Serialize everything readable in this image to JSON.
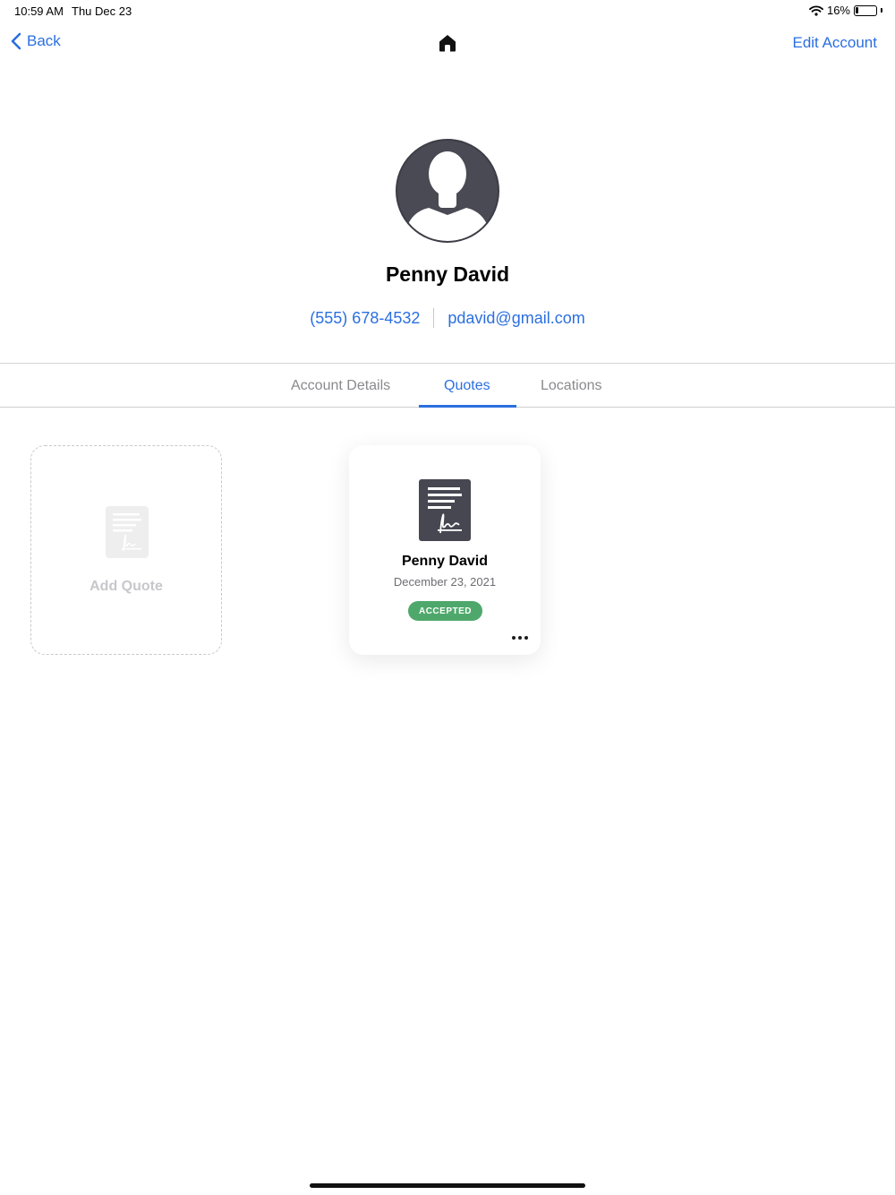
{
  "status_bar": {
    "time": "10:59 AM",
    "date": "Thu Dec 23",
    "battery": "16%",
    "battery_level": 0.16,
    "icons": [
      "wifi-icon",
      "battery-icon"
    ]
  },
  "nav": {
    "back_label": "Back",
    "edit_label": "Edit Account",
    "home_icon": "home-icon",
    "accent_color": "#2b6fe0"
  },
  "profile": {
    "name": "Penny David",
    "phone": "(555) 678-4532",
    "email": "pdavid@gmail.com",
    "avatar_icon": "person-silhouette-icon"
  },
  "tabs": [
    {
      "label": "Account Details",
      "active": false
    },
    {
      "label": "Quotes",
      "active": true
    },
    {
      "label": "Locations",
      "active": false
    }
  ],
  "add_quote": {
    "label": "Add Quote",
    "icon": "signed-document-icon"
  },
  "quotes": [
    {
      "name": "Penny David",
      "date": "December 23, 2021",
      "status": "ACCEPTED",
      "status_color": "#4fa86b",
      "icon": "signed-document-icon",
      "menu_icon": "more-horizontal-icon"
    }
  ]
}
